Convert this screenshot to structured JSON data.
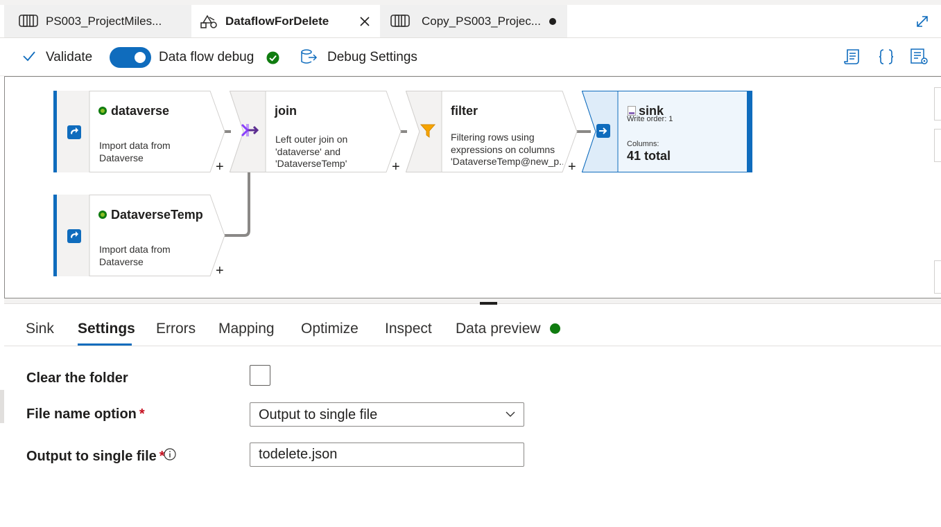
{
  "tabs": [
    {
      "label": "PS003_ProjectMiles...",
      "icon": "pipeline-icon",
      "state": "inactive"
    },
    {
      "label": "DataflowForDelete",
      "icon": "dataflow-icon",
      "state": "active",
      "close": "×"
    },
    {
      "label": "Copy_PS003_Projec...",
      "icon": "pipeline-icon",
      "state": "inactive",
      "unsaved": true
    }
  ],
  "toolbar": {
    "validate_label": "Validate",
    "debug_label": "Data flow debug",
    "debug_on": true,
    "debug_settings_label": "Debug Settings"
  },
  "canvas": {
    "nodes": {
      "dataverse": {
        "title": "dataverse",
        "description": "Import data from Dataverse",
        "icon": "source-dataset-icon"
      },
      "join": {
        "title": "join",
        "description": "Left outer join on 'dataverse' and 'DataverseTemp'",
        "icon": "join-icon"
      },
      "filter": {
        "title": "filter",
        "description": "Filtering rows using expressions on columns 'DataverseTemp@new_p...",
        "icon": "filter-funnel-icon"
      },
      "sink": {
        "title": "sink",
        "write_order": "Write order: 1",
        "columns_label": "Columns:",
        "columns_value": "41 total",
        "icon": "sink-dataset-icon"
      },
      "dataverse_temp": {
        "title": "DataverseTemp",
        "description": "Import data from Dataverse",
        "icon": "source-dataset-icon"
      }
    },
    "add_symbol": "+"
  },
  "bottom_tabs": [
    {
      "label": "Sink"
    },
    {
      "label": "Settings",
      "selected": true
    },
    {
      "label": "Errors"
    },
    {
      "label": "Mapping"
    },
    {
      "label": "Optimize"
    },
    {
      "label": "Inspect"
    },
    {
      "label": "Data preview",
      "status": "ready"
    }
  ],
  "settings": {
    "clear_folder": {
      "label": "Clear the folder",
      "checked": false
    },
    "file_name_option": {
      "label": "File name option",
      "required": "*",
      "value": "Output to single file"
    },
    "output_single_file": {
      "label": "Output to single file",
      "required": "*",
      "value": "todelete.json"
    }
  },
  "colors": {
    "accent": "#0f6cbd",
    "success": "#107c10",
    "selected_node_bg": "#eff6fc",
    "join_icon": "#8a3ffc",
    "filter_icon": "#f7a400"
  }
}
